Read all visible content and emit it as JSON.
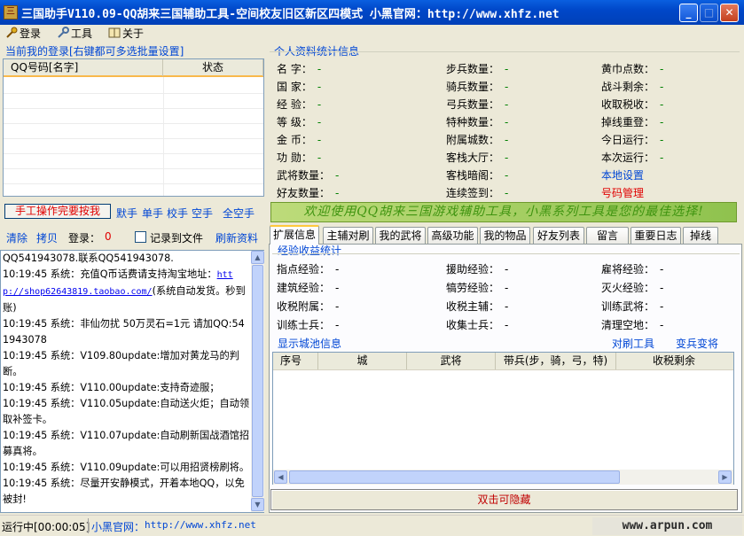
{
  "window": {
    "title": "三国助手V110.09-QQ胡来三国辅助工具-空间校友旧区新区四模式 小黑官网：http://www.xhfz.net",
    "icon": "app-icon"
  },
  "menu": {
    "login": "登录",
    "tools": "工具",
    "about": "关于"
  },
  "accounts": {
    "group_title": "当前我的登录[右键都可多选批量设置]",
    "col_qq": "QQ号码[名字]",
    "col_status": "状态"
  },
  "actions": {
    "manual": "手工操作完要按我",
    "default_hands": "默手",
    "single_hand": "单手",
    "school_hand": "校手",
    "empty_hand": "空手",
    "all_empty_hand": "全空手"
  },
  "logbar": {
    "clear": "清除",
    "copy": "拷贝",
    "login_label": "登录：",
    "login_count": "0",
    "record_to_file": "记录到文件",
    "refresh": "刷新资料"
  },
  "log": [
    {
      "text": "QQ541943078.联系QQ541943078."
    },
    {
      "text": "10:19:45 系统：充值Q币话费请支持淘宝地址：",
      "link": "http://shop62643819.taobao.com/",
      "after": "(系统自动发货。秒到账)"
    },
    {
      "text": "10:19:45 系统：非仙勿扰 50万灵石=1元 请加QQ:541943078"
    },
    {
      "text": "10:19:45 系统：V109.80update:增加对黄龙马的判断。"
    },
    {
      "text": "10:19:45 系统：V110.00update:支持奇迹服；"
    },
    {
      "text": "10:19:45 系统：V110.05update:自动送火炬；自动领取补签卡。"
    },
    {
      "text": "10:19:45 系统：V110.07update:自动刷新国战酒馆招募真将。"
    },
    {
      "text": "10:19:45 系统：V110.09update:可以用招贤榜刷将。"
    },
    {
      "text": "10:19:45 系统：尽量开安静模式，开着本地QQ，以免被封!"
    }
  ],
  "stats": {
    "group_title": "个人资料统计信息",
    "col1": [
      {
        "label": "名    字：",
        "value": "-"
      },
      {
        "label": "国    家：",
        "value": "-"
      },
      {
        "label": "经    验：",
        "value": "-"
      },
      {
        "label": "等    级：",
        "value": "-"
      },
      {
        "label": "金    币：",
        "value": "-"
      },
      {
        "label": "功    勋：",
        "value": "-"
      },
      {
        "label": "武将数量：",
        "value": "-"
      },
      {
        "label": "好友数量：",
        "value": "-"
      }
    ],
    "col2": [
      {
        "label": "步兵数量：",
        "value": "-"
      },
      {
        "label": "骑兵数量：",
        "value": "-"
      },
      {
        "label": "弓兵数量：",
        "value": "-"
      },
      {
        "label": "特种数量：",
        "value": "-"
      },
      {
        "label": "附属城数：",
        "value": "-"
      },
      {
        "label": "客栈大厅：",
        "value": "-"
      },
      {
        "label": "客栈暗阁：",
        "value": "-"
      },
      {
        "label": "连续签到：",
        "value": "-"
      }
    ],
    "col3": [
      {
        "label": "黄巾点数：",
        "value": "-"
      },
      {
        "label": "战斗剩余：",
        "value": "-"
      },
      {
        "label": "收取税收：",
        "value": "-"
      },
      {
        "label": "掉线重登：",
        "value": "-"
      },
      {
        "label": "今日运行：",
        "value": "-"
      },
      {
        "label": "本次运行：",
        "value": "-"
      }
    ],
    "local_settings": "本地设置",
    "number_mgmt": "号码管理"
  },
  "banner": "欢迎使用QQ胡来三国游戏辅助工具，小黑系列工具是您的最佳选择!",
  "tabs": [
    "扩展信息",
    "主辅对刷",
    "我的武将",
    "高级功能",
    "我的物品",
    "好友列表",
    "留言",
    "重要日志",
    "掉线"
  ],
  "exp": {
    "group_title": "经验收益统计",
    "rows": [
      [
        {
          "label": "指点经验：",
          "value": "-"
        },
        {
          "label": "援助经验：",
          "value": "-"
        },
        {
          "label": "雇将经验：",
          "value": "-"
        }
      ],
      [
        {
          "label": "建筑经验：",
          "value": "-"
        },
        {
          "label": "犒劳经验：",
          "value": "-"
        },
        {
          "label": "灭火经验：",
          "value": "-"
        }
      ],
      [
        {
          "label": "收税附属：",
          "value": "-"
        },
        {
          "label": "收税主辅：",
          "value": "-"
        },
        {
          "label": "训练武将：",
          "value": "-"
        }
      ],
      [
        {
          "label": "训练士兵：",
          "value": "-"
        },
        {
          "label": "收集士兵：",
          "value": "-"
        },
        {
          "label": "清理空地：",
          "value": "-"
        }
      ]
    ],
    "show_city": "显示城池信息",
    "pair_tool": "对刷工具",
    "change_troop": "变兵变将"
  },
  "city_grid": {
    "columns": [
      "序号",
      "城",
      "武将",
      "带兵(步，骑，弓，特)",
      "收税剩余"
    ]
  },
  "hide_button": "双击可隐藏",
  "status": {
    "running": "运行中[00:00:05]",
    "site_label": "小黑官网：",
    "site_url": "http://www.xhfz.net",
    "watermark": "www.arpun.com"
  }
}
